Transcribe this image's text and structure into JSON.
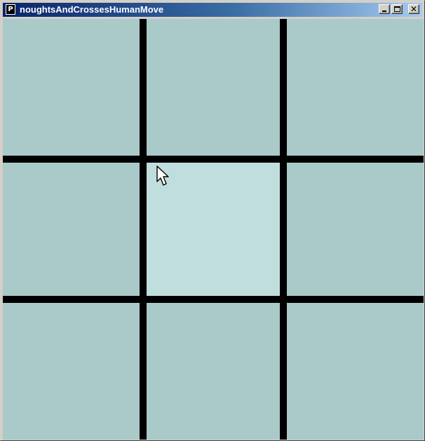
{
  "window": {
    "title": "noughtsAndCrossesHumanMove",
    "icon_letter": "P",
    "controls": [
      "minimize",
      "maximize",
      "close"
    ]
  },
  "board": {
    "rows": 3,
    "cols": 3,
    "hovered_cell": {
      "row": 1,
      "col": 1
    },
    "cells": [
      [
        "",
        "",
        ""
      ],
      [
        "",
        "",
        ""
      ],
      [
        "",
        "",
        ""
      ]
    ]
  },
  "colors": {
    "cell": "#aac9c9",
    "cell_hover": "#c0dede",
    "grid_line": "#000000",
    "titlebar_start": "#0a246a",
    "titlebar_end": "#a6caf0"
  },
  "icons": {
    "app": "processing-app-icon",
    "minimize": "minimize-icon",
    "maximize": "maximize-icon",
    "close": "close-icon",
    "cursor": "arrow-cursor-icon"
  }
}
